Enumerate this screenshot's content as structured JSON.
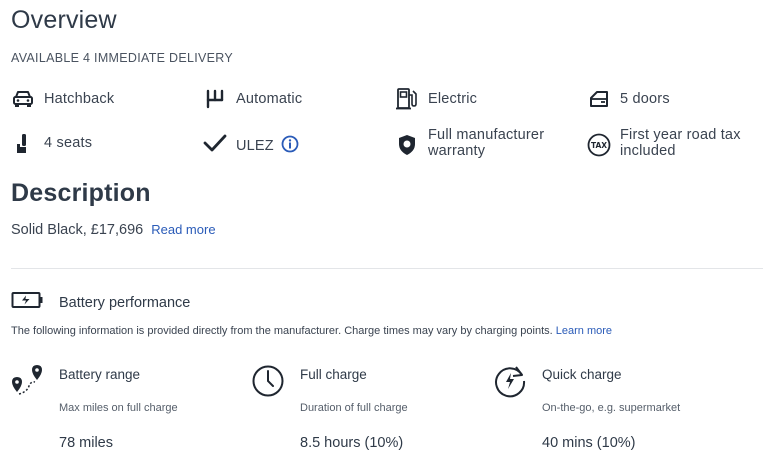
{
  "overview": {
    "title": "Overview",
    "availability": "AVAILABLE 4 IMMEDIATE DELIVERY"
  },
  "specs": {
    "body": {
      "label": "Hatchback",
      "icon": "car-icon"
    },
    "transmission": {
      "label": "Automatic",
      "icon": "gearbox-icon"
    },
    "fuel": {
      "label": "Electric",
      "icon": "fuel-pump-icon"
    },
    "doors": {
      "label": "5 doors",
      "icon": "car-door-icon"
    },
    "seats": {
      "label": "4 seats",
      "icon": "seat-icon"
    },
    "ulez": {
      "label": "ULEZ",
      "icon": "checkmark-icon",
      "info_icon": "info-icon"
    },
    "warranty": {
      "label_line1": "Full manufacturer",
      "label_line2": "warranty",
      "icon": "shield-icon"
    },
    "road_tax": {
      "label_line1": "First year road tax",
      "label_line2": "included",
      "icon": "tax-icon"
    }
  },
  "description": {
    "title": "Description",
    "text": "Solid Black, £17,696",
    "read_more": "Read more"
  },
  "battery": {
    "title": "Battery performance",
    "icon": "battery-icon",
    "note": "The following information is provided directly from the manufacturer. Charge times may vary by charging points.",
    "learn_more": "Learn more",
    "items": [
      {
        "title": "Battery range",
        "subtitle": "Max miles on full charge",
        "value": "78 miles",
        "icon": "map-pin-icon"
      },
      {
        "title": "Full charge",
        "subtitle": "Duration of full charge",
        "value": "8.5 hours (10%)",
        "icon": "clock-icon"
      },
      {
        "title": "Quick charge",
        "subtitle": "On-the-go, e.g. supermarket",
        "value": "40 mins (10%)",
        "icon": "quick-charge-icon"
      }
    ]
  },
  "colors": {
    "link": "#2a5bb8",
    "text": "#2f3a48",
    "divider": "#e3e5e8"
  }
}
